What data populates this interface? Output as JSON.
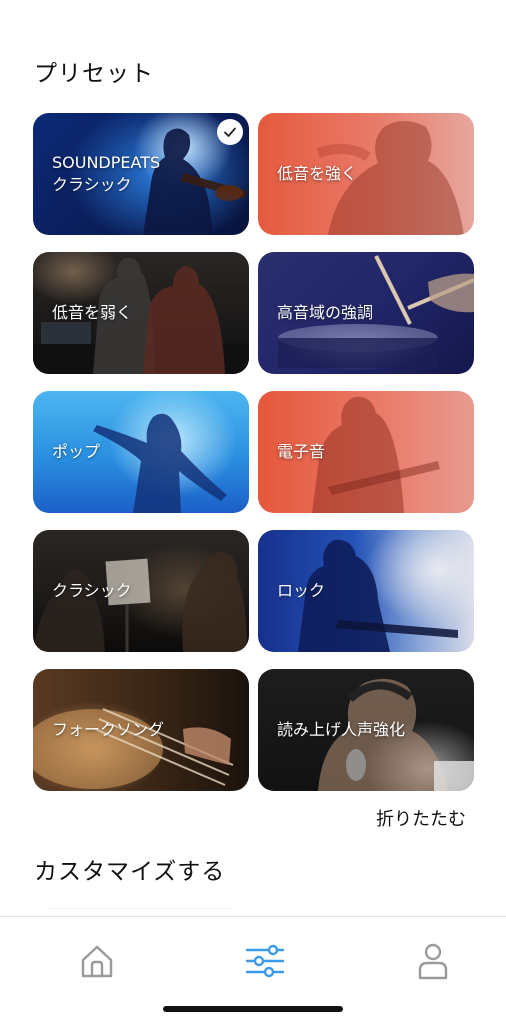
{
  "presets": {
    "title": "プリセット",
    "collapse_label": "折りたたむ",
    "selected_index": 0,
    "items": [
      {
        "line1": "SOUNDPEATS",
        "line2": "クラシック",
        "selected": true,
        "image": "violinist-blue"
      },
      {
        "line1": "低音を強く",
        "line2": "",
        "selected": false,
        "image": "singer-red"
      },
      {
        "line1": "低音を弱く",
        "line2": "",
        "selected": false,
        "image": "studio-musicians"
      },
      {
        "line1": "高音域の強調",
        "line2": "",
        "selected": false,
        "image": "drummer-navy"
      },
      {
        "line1": "ポップ",
        "line2": "",
        "selected": false,
        "image": "dancer-blue"
      },
      {
        "line1": "電子音",
        "line2": "",
        "selected": false,
        "image": "guitarist-red"
      },
      {
        "line1": "クラシック",
        "line2": "",
        "selected": false,
        "image": "orchestra"
      },
      {
        "line1": "ロック",
        "line2": "",
        "selected": false,
        "image": "rock-guitarist-smoke"
      },
      {
        "line1": "フォークソング",
        "line2": "",
        "selected": false,
        "image": "acoustic-guitar"
      },
      {
        "line1": "読み上げ人声強化",
        "line2": "",
        "selected": false,
        "image": "vocalist-mic"
      }
    ]
  },
  "customize": {
    "title": "カスタマイズする"
  },
  "tabbar": {
    "active": "equalizer",
    "tabs": [
      {
        "name": "home",
        "icon": "home-icon"
      },
      {
        "name": "equalizer",
        "icon": "sliders-icon"
      },
      {
        "name": "profile",
        "icon": "person-icon"
      }
    ]
  },
  "colors": {
    "accent": "#3b9be8",
    "icon_inactive": "#9a9a9a",
    "check_mark": "#222222"
  }
}
